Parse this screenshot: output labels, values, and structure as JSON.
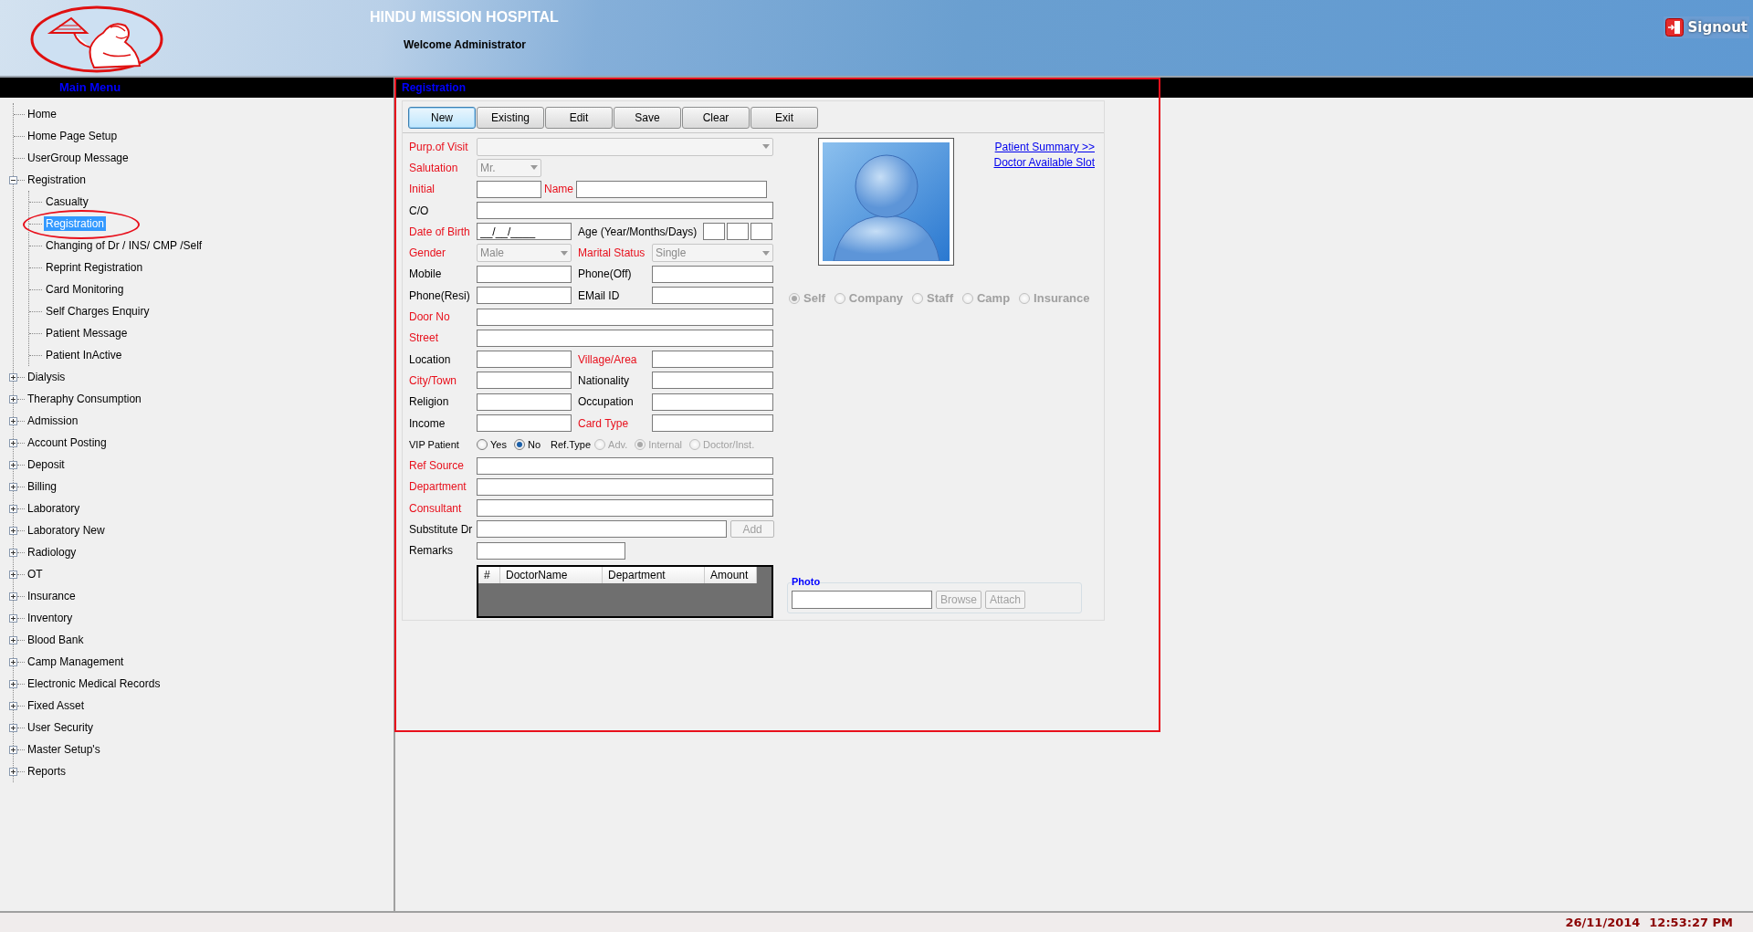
{
  "header": {
    "title": "HINDU MISSION HOSPITAL",
    "welcome": "Welcome Administrator",
    "signout": "Signout"
  },
  "sidebar": {
    "title": "Main Menu",
    "items": [
      {
        "label": "Home",
        "selected": false
      },
      {
        "label": "Home Page Setup",
        "selected": false
      },
      {
        "label": "UserGroup Message",
        "selected": false
      },
      {
        "label": "Registration",
        "selected": false,
        "expanded": true,
        "children": [
          {
            "label": "Casualty",
            "selected": false
          },
          {
            "label": "Registration",
            "selected": true
          },
          {
            "label": "Changing of Dr / INS/ CMP /Self",
            "selected": false
          },
          {
            "label": "Reprint Registration",
            "selected": false
          },
          {
            "label": "Card Monitoring",
            "selected": false
          },
          {
            "label": "Self Charges Enquiry",
            "selected": false
          },
          {
            "label": "Patient Message",
            "selected": false
          },
          {
            "label": "Patient InActive",
            "selected": false
          }
        ]
      },
      {
        "label": "Dialysis",
        "selected": false,
        "expanded": false
      },
      {
        "label": "Theraphy Consumption",
        "selected": false,
        "expanded": false
      },
      {
        "label": "Admission",
        "selected": false,
        "expanded": false
      },
      {
        "label": "Account Posting",
        "selected": false,
        "expanded": false
      },
      {
        "label": "Deposit",
        "selected": false,
        "expanded": false
      },
      {
        "label": "Billing",
        "selected": false,
        "expanded": false
      },
      {
        "label": "Laboratory",
        "selected": false,
        "expanded": false
      },
      {
        "label": "Laboratory New",
        "selected": false,
        "expanded": false
      },
      {
        "label": "Radiology",
        "selected": false,
        "expanded": false
      },
      {
        "label": "OT",
        "selected": false,
        "expanded": false
      },
      {
        "label": "Insurance",
        "selected": false,
        "expanded": false
      },
      {
        "label": "Inventory",
        "selected": false,
        "expanded": false
      },
      {
        "label": "Blood Bank",
        "selected": false,
        "expanded": false
      },
      {
        "label": "Camp Management",
        "selected": false,
        "expanded": false
      },
      {
        "label": "Electronic Medical Records",
        "selected": false,
        "expanded": false
      },
      {
        "label": "Fixed Asset",
        "selected": false,
        "expanded": false
      },
      {
        "label": "User Security",
        "selected": false,
        "expanded": false
      },
      {
        "label": "Master Setup's",
        "selected": false,
        "expanded": false
      },
      {
        "label": "Reports",
        "selected": false,
        "expanded": false
      }
    ]
  },
  "registration": {
    "title": "Registration",
    "toolbar": [
      {
        "label": "New",
        "focused": true
      },
      {
        "label": "Existing",
        "focused": false
      },
      {
        "label": "Edit",
        "focused": false
      },
      {
        "label": "Save",
        "focused": false
      },
      {
        "label": "Clear",
        "focused": false
      },
      {
        "label": "Exit",
        "focused": false
      }
    ],
    "rows": [
      {
        "kind": "select_full",
        "label": "Purp.of Visit",
        "required": true,
        "disabled": true
      },
      {
        "kind": "select_short",
        "label": "Salutation",
        "required": true,
        "value": "Mr.",
        "disabled": true
      },
      {
        "kind": "initial_name",
        "label": "Initial",
        "required": true,
        "name_label": "Name",
        "name_required": true
      },
      {
        "kind": "text_full",
        "label": "C/O",
        "required": false
      },
      {
        "kind": "dob",
        "label": "Date of Birth",
        "required": true,
        "value": "__/__/____",
        "age_label": "Age (Year/Months/Days)"
      },
      {
        "kind": "pair",
        "left": {
          "label": "Gender",
          "required": true,
          "kind": "select",
          "value": "Male",
          "disabled": true
        },
        "right": {
          "label": "Marital Status",
          "required": true,
          "kind": "select",
          "value": "Single",
          "disabled": true
        }
      },
      {
        "kind": "pair",
        "left": {
          "label": "Mobile",
          "required": false,
          "kind": "text"
        },
        "right": {
          "label": "Phone(Off)",
          "required": false,
          "kind": "text"
        }
      },
      {
        "kind": "pair",
        "left": {
          "label": "Phone(Resi)",
          "required": false,
          "kind": "text"
        },
        "right": {
          "label": "EMail ID",
          "required": false,
          "kind": "text"
        }
      },
      {
        "kind": "text_full",
        "label": "Door No",
        "required": true
      },
      {
        "kind": "text_full",
        "label": "Street",
        "required": true
      },
      {
        "kind": "pair",
        "left": {
          "label": "Location",
          "required": false,
          "kind": "text"
        },
        "right": {
          "label": "Village/Area",
          "required": true,
          "kind": "text"
        }
      },
      {
        "kind": "pair",
        "left": {
          "label": "City/Town",
          "required": true,
          "kind": "text"
        },
        "right": {
          "label": "Nationality",
          "required": false,
          "kind": "text"
        }
      },
      {
        "kind": "pair",
        "left": {
          "label": "Religion",
          "required": false,
          "kind": "text"
        },
        "right": {
          "label": "Occupation",
          "required": false,
          "kind": "text"
        }
      },
      {
        "kind": "pair",
        "left": {
          "label": "Income",
          "required": false,
          "kind": "text"
        },
        "right": {
          "label": "Card Type",
          "required": true,
          "kind": "text"
        }
      },
      {
        "kind": "vip",
        "label": "VIP Patient",
        "required": false,
        "options": [
          {
            "label": "Yes",
            "selected": false
          },
          {
            "label": "No",
            "selected": true
          }
        ],
        "ref_label": "Ref.Type",
        "ref_disabled": true,
        "ref_options": [
          {
            "label": "Adv.",
            "selected": false
          },
          {
            "label": "Internal",
            "selected": true
          },
          {
            "label": "Doctor/Inst.",
            "selected": false
          }
        ]
      },
      {
        "kind": "text_full",
        "label": "Ref Source",
        "required": true
      },
      {
        "kind": "text_full",
        "label": "Department",
        "required": true
      },
      {
        "kind": "text_full",
        "label": "Consultant",
        "required": true
      },
      {
        "kind": "substitute",
        "label": "Substitute Dr",
        "required": false,
        "button": "Add",
        "button_disabled": true
      },
      {
        "kind": "text_short",
        "label": "Remarks",
        "required": false
      }
    ],
    "grid": {
      "columns": [
        "#",
        "DoctorName",
        "Department",
        "Amount"
      ]
    },
    "links": [
      "Patient Summary >>",
      "Doctor Available Slot"
    ],
    "patient_type": {
      "disabled": true,
      "options": [
        {
          "label": "Self",
          "selected": true
        },
        {
          "label": "Company",
          "selected": false
        },
        {
          "label": "Staff",
          "selected": false
        },
        {
          "label": "Camp",
          "selected": false
        },
        {
          "label": "Insurance",
          "selected": false
        }
      ]
    },
    "photo": {
      "legend": "Photo",
      "buttons": [
        {
          "label": "Browse",
          "disabled": true
        },
        {
          "label": "Attach",
          "disabled": true
        }
      ]
    }
  },
  "status_bar": {
    "date": "26/11/2014",
    "time": "12:53:27 PM"
  }
}
